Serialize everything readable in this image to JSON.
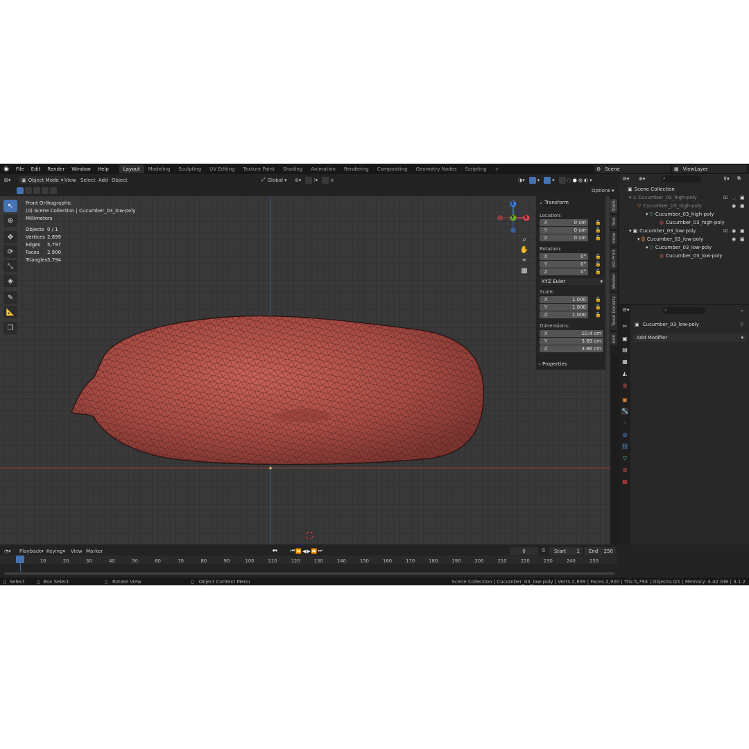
{
  "menu": {
    "items": [
      "File",
      "Edit",
      "Render",
      "Window",
      "Help"
    ],
    "workspaces": [
      "Layout",
      "Modeling",
      "Sculpting",
      "UV Editing",
      "Texture Paint",
      "Shading",
      "Animation",
      "Rendering",
      "Compositing",
      "Geometry Nodes",
      "Scripting"
    ],
    "add": "+",
    "scene": "Scene",
    "view_layer": "ViewLayer"
  },
  "header": {
    "mode": "Object Mode",
    "menus": [
      "View",
      "Select",
      "Add",
      "Object"
    ],
    "orientation": "Global",
    "options": "Options"
  },
  "viewport": {
    "view_name": "Front Orthographic",
    "collection": "(0) Scene Collection | Cucumber_03_low-poly",
    "units": "Millimeters",
    "stats": [
      {
        "k": "Objects",
        "v": "0 / 1"
      },
      {
        "k": "Vertices",
        "v": "2,899"
      },
      {
        "k": "Edges",
        "v": "5,797"
      },
      {
        "k": "Faces",
        "v": "2,900"
      },
      {
        "k": "Triangles",
        "v": "5,794"
      }
    ],
    "gizmo": {
      "z": "Z",
      "y": "Y",
      "x": "X"
    }
  },
  "npanel": {
    "transform": "Transform",
    "location_label": "Location:",
    "location": [
      {
        "ax": "X",
        "v": "0 cm"
      },
      {
        "ax": "Y",
        "v": "0 cm"
      },
      {
        "ax": "Z",
        "v": "0 cm"
      }
    ],
    "rotation_label": "Rotation:",
    "rotation": [
      {
        "ax": "X",
        "v": "0°"
      },
      {
        "ax": "Y",
        "v": "0°"
      },
      {
        "ax": "Z",
        "v": "0°"
      }
    ],
    "rotation_mode": "XYZ Euler",
    "scale_label": "Scale:",
    "scale": [
      {
        "ax": "X",
        "v": "1.000"
      },
      {
        "ax": "Y",
        "v": "1.000"
      },
      {
        "ax": "Z",
        "v": "1.000"
      }
    ],
    "dimensions_label": "Dimensions:",
    "dimensions": [
      {
        "ax": "X",
        "v": "10.4 cm"
      },
      {
        "ax": "Y",
        "v": "3.69 cm"
      },
      {
        "ax": "Z",
        "v": "3.66 cm"
      }
    ],
    "properties": "Properties",
    "tabs": [
      "Item",
      "Tool",
      "View",
      "3D-Print",
      "Welder",
      "Texel Density",
      "Edit"
    ]
  },
  "outliner": {
    "rows": [
      {
        "label": "Scene Collection",
        "dim": false
      },
      {
        "label": "Cucumber_03_high-poly",
        "dim": true
      },
      {
        "label": "Cucumber_03_high-poly",
        "dim": true
      },
      {
        "label": "Cucumber_03_high-poly",
        "dim": false
      },
      {
        "label": "Cucumber_03_high-poly",
        "dim": false
      },
      {
        "label": "Cucumber_03_low-poly",
        "dim": false
      },
      {
        "label": "Cucumber_03_low-poly",
        "dim": false
      },
      {
        "label": "Cucumber_03_low-poly",
        "dim": false
      },
      {
        "label": "Cucumber_03_low-poly",
        "dim": false
      }
    ]
  },
  "properties": {
    "object_name": "Cucumber_03_low-poly",
    "add_modifier": "Add Modifier"
  },
  "timeline": {
    "menus": [
      "Playback",
      "Keying",
      "View",
      "Marker"
    ],
    "current_frame": "0",
    "start_label": "Start",
    "start": "1",
    "end_label": "End",
    "end": "250",
    "ticks": [
      "0",
      "10",
      "20",
      "30",
      "40",
      "50",
      "60",
      "70",
      "80",
      "90",
      "100",
      "110",
      "120",
      "130",
      "140",
      "150",
      "160",
      "170",
      "180",
      "190",
      "200",
      "210",
      "220",
      "230",
      "240",
      "250"
    ]
  },
  "status": {
    "select": "Select",
    "box_select": "Box Select",
    "rotate_view": "Rotate View",
    "context_menu": "Object Context Menu",
    "info": "Scene Collection | Cucumber_03_low-poly | Verts:2,899 | Faces:2,900 | Tris:5,794 | Objects:0/1 | Memory: 4.42 GiB | 3.1.2"
  },
  "colors": {
    "accent": "#4772b3",
    "mesh": "#b2534c",
    "x_axis": "#e0444f",
    "y_axis": "#6ba52a",
    "z_axis": "#3d7fe0"
  }
}
